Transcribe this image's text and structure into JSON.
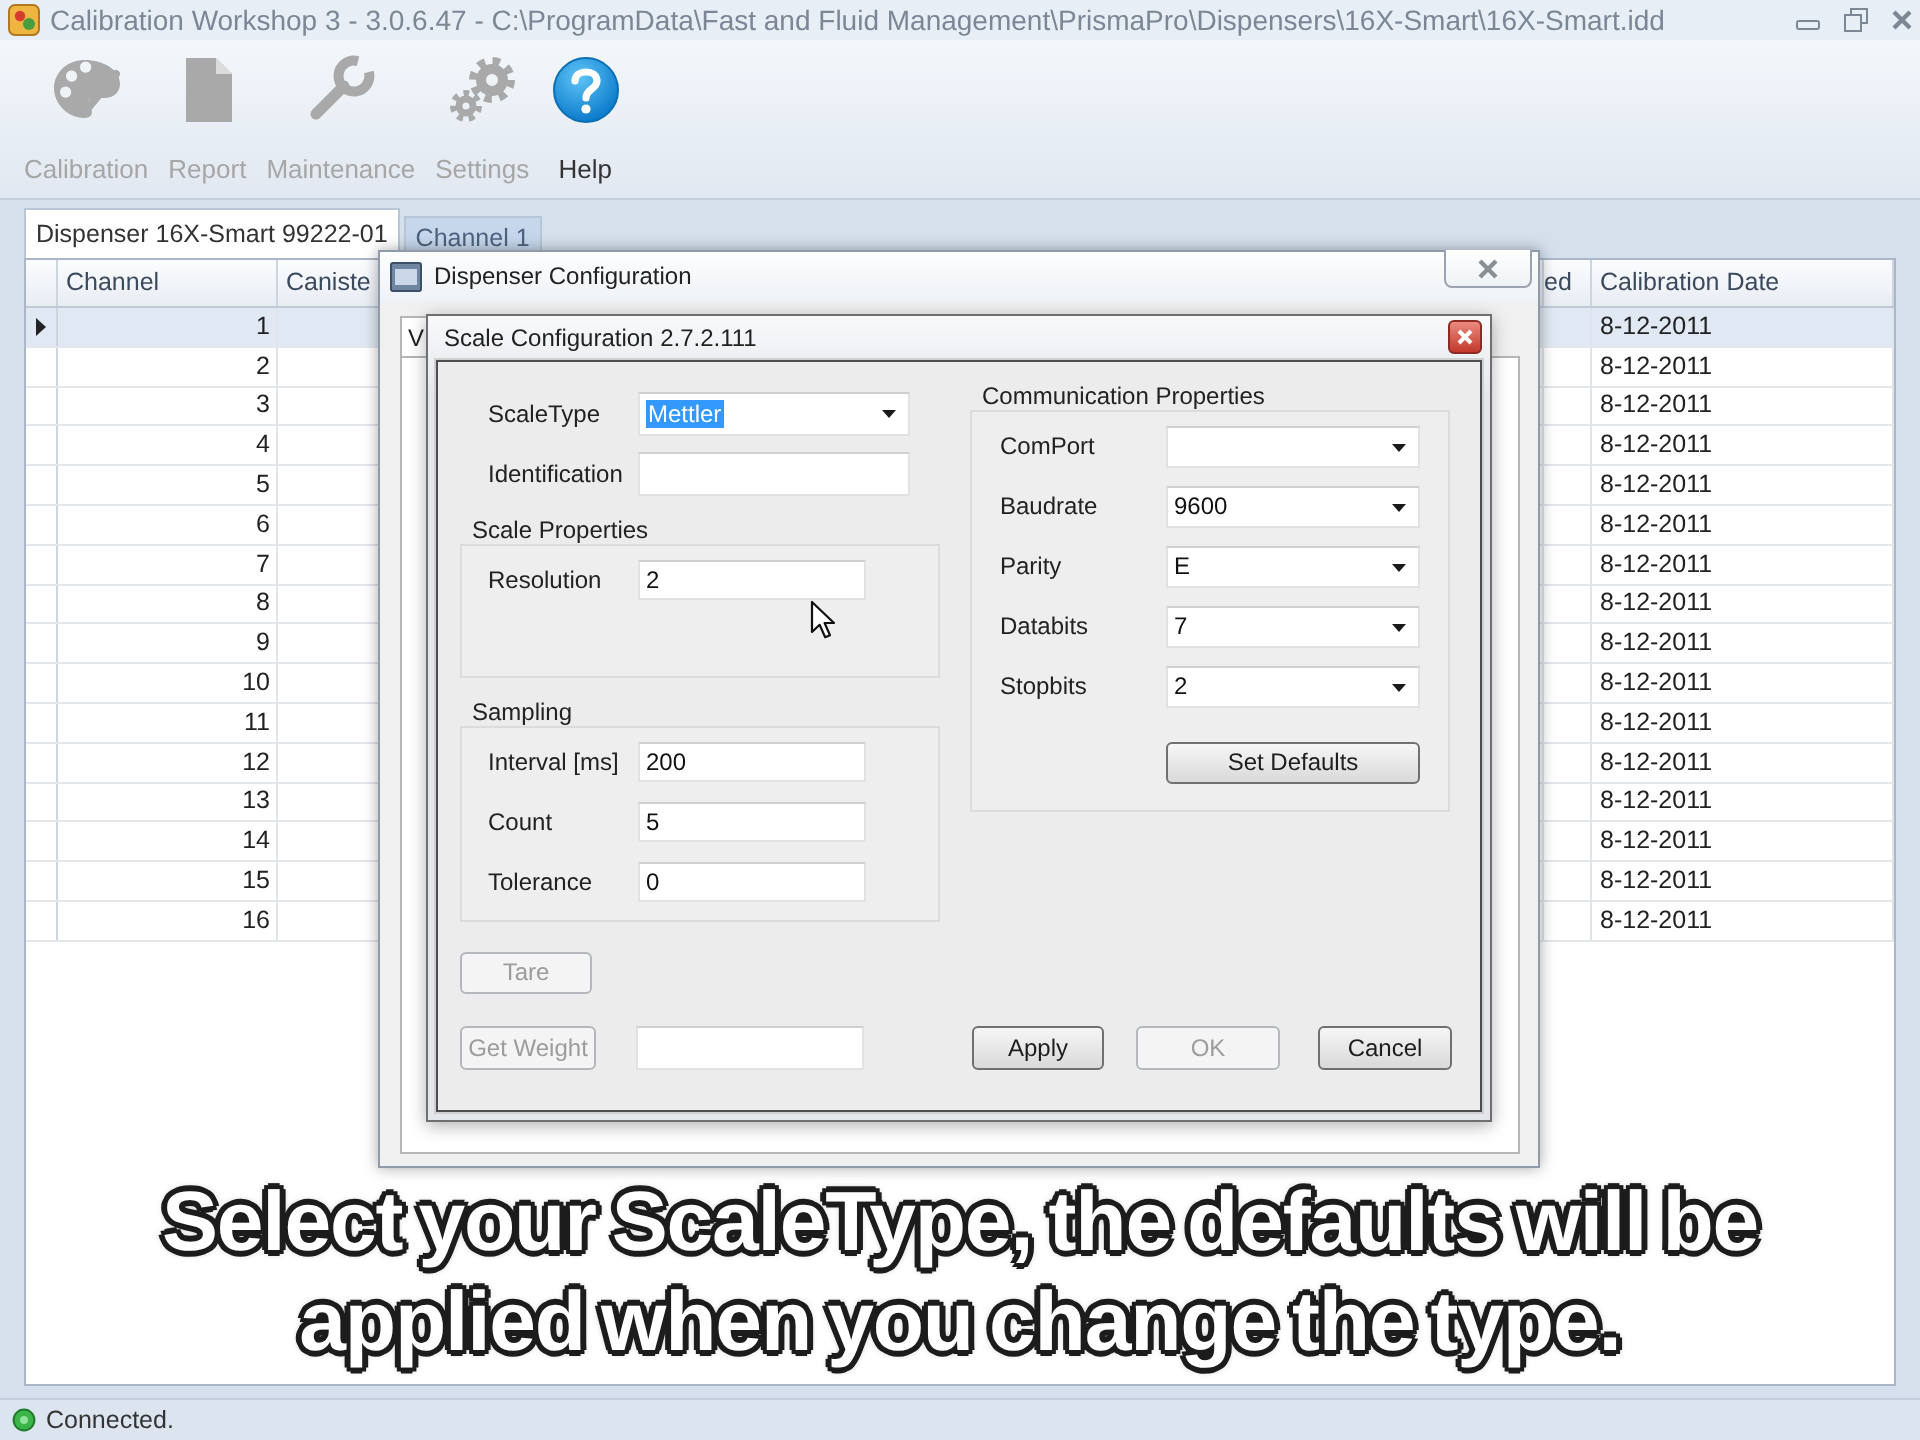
{
  "window": {
    "title": "Calibration Workshop 3 - 3.0.6.47 - C:\\ProgramData\\Fast and Fluid Management\\PrismaPro\\Dispensers\\16X-Smart\\16X-Smart.idd"
  },
  "toolbar": [
    {
      "kind": "palette",
      "label": "Calibration",
      "disabled": true
    },
    {
      "kind": "document",
      "label": "Report",
      "disabled": true
    },
    {
      "kind": "wrench",
      "label": "Maintenance",
      "disabled": true
    },
    {
      "kind": "gears",
      "label": "Settings",
      "disabled": true
    },
    {
      "kind": "help",
      "label": "Help",
      "disabled": false
    }
  ],
  "tabs": [
    {
      "label": "Dispenser 16X-Smart 99222-01",
      "selected": true
    },
    {
      "label": "Channel 1",
      "selected": false
    }
  ],
  "table": {
    "columns": [
      "Channel",
      "Caniste",
      "ed",
      "Calibration Date"
    ],
    "rows": [
      {
        "channel": "1",
        "calibration_date": "8-12-2011",
        "selected": true
      },
      {
        "channel": "2",
        "calibration_date": "8-12-2011",
        "selected": false
      },
      {
        "channel": "3",
        "calibration_date": "8-12-2011",
        "selected": false
      },
      {
        "channel": "4",
        "calibration_date": "8-12-2011",
        "selected": false
      },
      {
        "channel": "5",
        "calibration_date": "8-12-2011",
        "selected": false
      },
      {
        "channel": "6",
        "calibration_date": "8-12-2011",
        "selected": false
      },
      {
        "channel": "7",
        "calibration_date": "8-12-2011",
        "selected": false
      },
      {
        "channel": "8",
        "calibration_date": "8-12-2011",
        "selected": false
      },
      {
        "channel": "9",
        "calibration_date": "8-12-2011",
        "selected": false
      },
      {
        "channel": "10",
        "calibration_date": "8-12-2011",
        "selected": false
      },
      {
        "channel": "11",
        "calibration_date": "8-12-2011",
        "selected": false
      },
      {
        "channel": "12",
        "calibration_date": "8-12-2011",
        "selected": false
      },
      {
        "channel": "13",
        "calibration_date": "8-12-2011",
        "selected": false
      },
      {
        "channel": "14",
        "calibration_date": "8-12-2011",
        "selected": false
      },
      {
        "channel": "15",
        "calibration_date": "8-12-2011",
        "selected": false
      },
      {
        "channel": "16",
        "calibration_date": "8-12-2011",
        "selected": false
      }
    ]
  },
  "dispenser_dialog": {
    "title": "Dispenser Configuration",
    "tabs": [
      {
        "label": "V",
        "selected": true
      }
    ]
  },
  "scale_dialog": {
    "title": "Scale Configuration 2.7.2.111",
    "fields": [
      {
        "label": "ScaleType",
        "kind": "dropdown",
        "value": "Mettler",
        "focused": true
      },
      {
        "label": "Identification",
        "kind": "text",
        "focused": false
      }
    ],
    "scale_properties": {
      "title": "Scale Properties",
      "fields": [
        {
          "label": "Resolution",
          "value": "2"
        }
      ]
    },
    "sampling": {
      "title": "Sampling",
      "fields": [
        {
          "label": "Interval [ms]",
          "value": "200"
        },
        {
          "label": "Count",
          "value": "5"
        },
        {
          "label": "Tolerance",
          "value": "0"
        }
      ]
    },
    "tare_button": {
      "label": "Tare",
      "disabled": true
    },
    "get_weight_button": {
      "label": "Get Weight",
      "disabled": true
    },
    "communication": {
      "title": "Communication Properties",
      "fields": [
        {
          "label": "ComPort"
        },
        {
          "label": "Baudrate",
          "value": "9600"
        },
        {
          "label": "Parity",
          "value": "E"
        },
        {
          "label": "Databits",
          "value": "7"
        },
        {
          "label": "Stopbits",
          "value": "2"
        }
      ],
      "set_defaults_button": {
        "label": "Set Defaults",
        "disabled": false
      }
    },
    "buttons": [
      {
        "label": "Apply",
        "disabled": false
      },
      {
        "label": "OK",
        "disabled": true
      },
      {
        "label": "Cancel",
        "disabled": false
      }
    ]
  },
  "caption": {
    "lines": [
      "Select your ScaleType, the defaults will be",
      "applied when you change the type."
    ]
  },
  "status_bar": {
    "text": "Connected.",
    "connected": true
  }
}
